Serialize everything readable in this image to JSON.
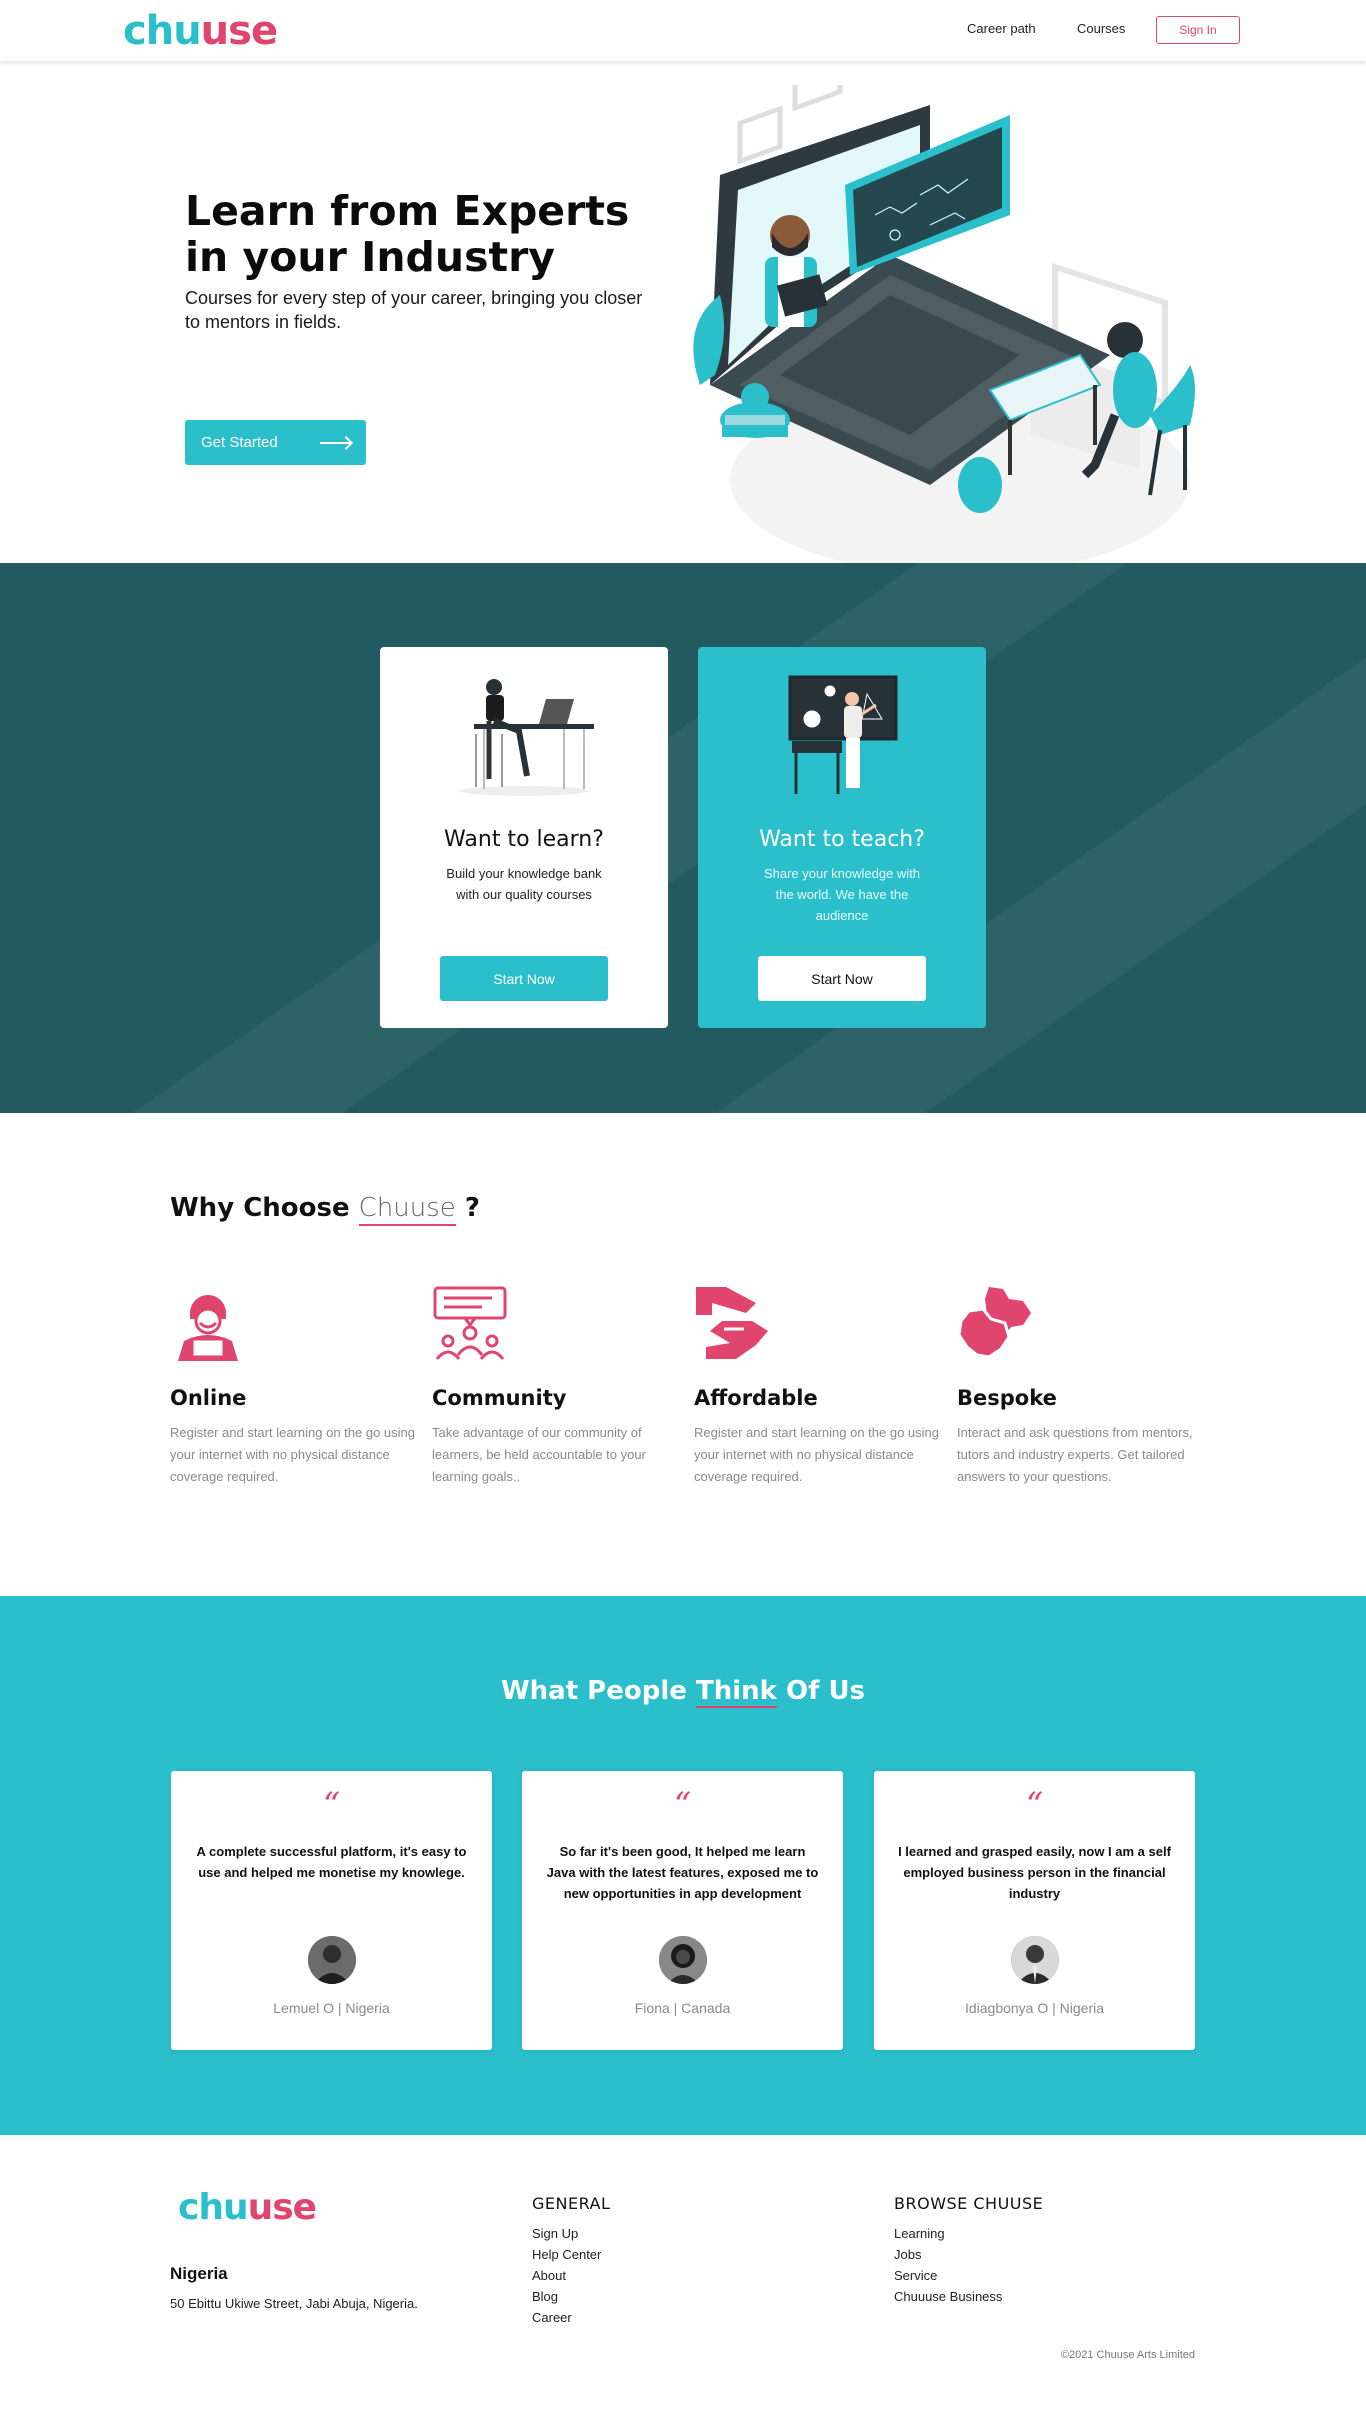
{
  "brand": {
    "logo_part1": "chu",
    "logo_part2": "use",
    "accent": "#2bbfcb",
    "pink": "#e0456e",
    "dark_teal": "#235a61"
  },
  "nav": {
    "links": [
      {
        "label": "Career path"
      },
      {
        "label": "Courses"
      }
    ],
    "signin_label": "Sign In"
  },
  "hero": {
    "title": "Learn from Experts in your Industry",
    "subtitle": "Courses for every step of your career, bringing you closer to mentors in fields.",
    "cta_label": "Get Started"
  },
  "cards": {
    "learn": {
      "title": "Want to learn?",
      "text": "Build your knowledge bank with our quality courses",
      "button": "Start Now"
    },
    "teach": {
      "title": "Want to teach?",
      "text": "Share your knowledge with the world. We have the audience",
      "button": "Start Now"
    }
  },
  "why": {
    "title_prefix": "Why Choose ",
    "title_brand": "Chuuse",
    "title_suffix": " ?",
    "features": [
      {
        "icon": "online-learner-icon",
        "title": "Online",
        "text": "Register and start learning on the go using your internet with no physical distance coverage required."
      },
      {
        "icon": "community-icon",
        "title": "Community",
        "text": "Take advantage of our community of learners, be held accountable to your learning goals.."
      },
      {
        "icon": "hand-offer-icon",
        "title": "Affordable",
        "text": "Register and start learning on the go using your internet with no physical distance coverage required."
      },
      {
        "icon": "puzzle-badges-icon",
        "title": "Bespoke",
        "text": "Interact and ask questions from mentors, tutors and industry experts. Get tailored answers to your questions."
      }
    ]
  },
  "testimonials": {
    "title_prefix": "What People ",
    "title_highlight": "Think",
    "title_suffix": " Of Us",
    "quote_mark": "“",
    "items": [
      {
        "message": "A complete successful platform, it's easy to use and helped me monetise my knowlege.",
        "name": "Lemuel O | Nigeria"
      },
      {
        "message": "So far it's been good, It helped me learn Java with the latest features, exposed me to new opportunities in app development",
        "name": "Fiona | Canada"
      },
      {
        "message": "I learned and grasped easily, now I am a self employed business person in the financial industry",
        "name": "Idiagbonya O | Nigeria"
      }
    ]
  },
  "footer": {
    "country": "Nigeria",
    "address": "50 Ebittu Ukiwe Street, Jabi Abuja, Nigeria.",
    "general": {
      "heading": "GENERAL",
      "links": [
        "Sign Up",
        "Help Center",
        "About",
        "Blog",
        "Career"
      ]
    },
    "browse": {
      "heading": "BROWSE CHUUSE",
      "links": [
        "Learning",
        "Jobs",
        "Service",
        "Chuuuse Business"
      ]
    },
    "copyright": "©2021 Chuuse Arts Limited"
  }
}
